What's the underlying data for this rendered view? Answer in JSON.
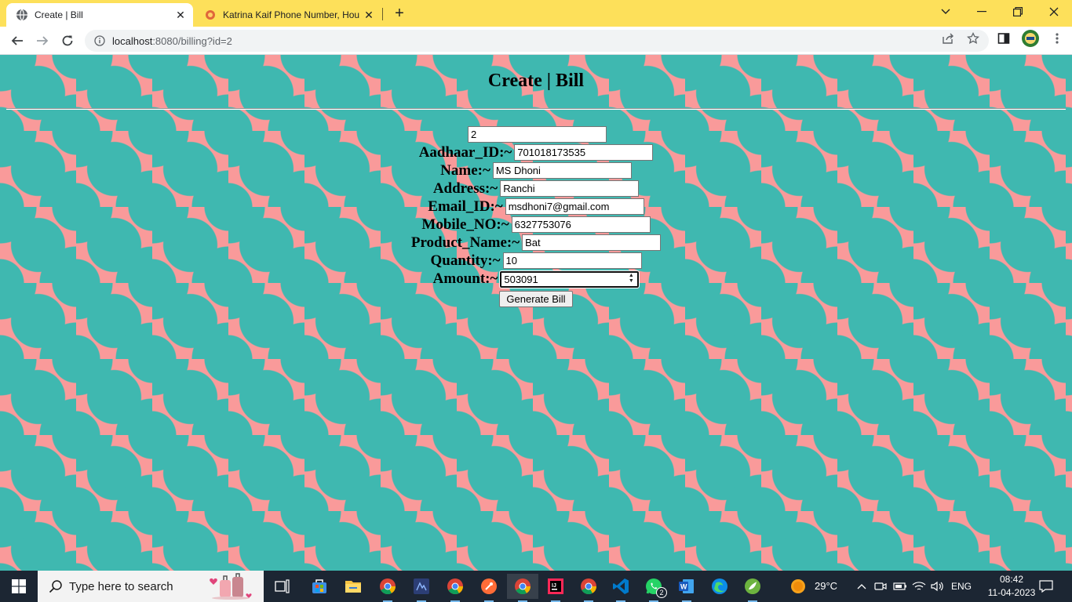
{
  "browser": {
    "tabs": [
      {
        "title": "Create | Bill",
        "active": true
      },
      {
        "title": "Katrina Kaif Phone Number, Hou",
        "active": false
      }
    ],
    "url_host": "localhost",
    "url_rest": ":8080/billing?id=2"
  },
  "page": {
    "title": "Create | Bill",
    "id_value": "2",
    "fields": [
      {
        "label": "Aadhaar_ID:~",
        "value": "701018173535"
      },
      {
        "label": "Name:~",
        "value": "MS Dhoni"
      },
      {
        "label": "Address:~",
        "value": "Ranchi"
      },
      {
        "label": "Email_ID:~",
        "value": "msdhoni7@gmail.com"
      },
      {
        "label": "Mobile_NO:~",
        "value": "6327753076"
      },
      {
        "label": "Product_Name:~",
        "value": "Bat"
      },
      {
        "label": "Quantity:~",
        "value": "10"
      },
      {
        "label": "Amount:~",
        "value": "503091"
      }
    ],
    "submit_label": "Generate Bill",
    "colors": {
      "teal": "#3fb8b0",
      "pink": "#f99a9a"
    }
  },
  "taskbar": {
    "search_placeholder": "Type here to search",
    "temperature": "29°C",
    "language": "ENG",
    "time": "08:42",
    "date": "11-04-2023",
    "whatsapp_badge": "2",
    "icons": [
      "task-view-icon",
      "microsoft-store-icon",
      "file-explorer-icon",
      "chrome-icon",
      "eclipse-icon",
      "chrome-icon",
      "postman-icon",
      "chrome-icon",
      "intellij-icon",
      "chrome-icon",
      "vscode-icon",
      "whatsapp-icon",
      "word-icon",
      "edge-icon",
      "spring-tools-icon"
    ]
  }
}
